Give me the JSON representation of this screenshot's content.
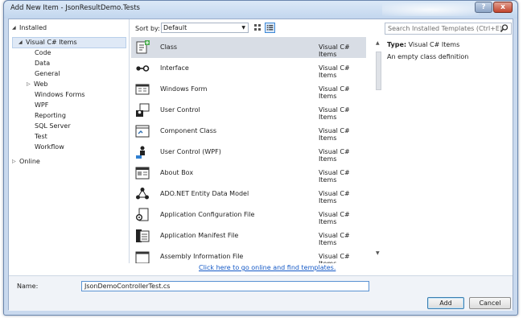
{
  "window": {
    "title": "Add New Item - JsonResultDemo.Tests",
    "help_label": "?",
    "close_label": "x"
  },
  "tree": {
    "installed": "Installed",
    "visual_cs": "Visual C# Items",
    "children": [
      "Code",
      "Data",
      "General",
      "Web",
      "Windows Forms",
      "WPF",
      "Reporting",
      "SQL Server",
      "Test",
      "Workflow"
    ],
    "online": "Online"
  },
  "sortbar": {
    "label": "Sort by:",
    "selected": "Default"
  },
  "templates": [
    {
      "name": "Class",
      "category": "Visual C# Items",
      "icon": "class-icon"
    },
    {
      "name": "Interface",
      "category": "Visual C# Items",
      "icon": "interface-icon"
    },
    {
      "name": "Windows Form",
      "category": "Visual C# Items",
      "icon": "windows-form-icon"
    },
    {
      "name": "User Control",
      "category": "Visual C# Items",
      "icon": "user-control-icon"
    },
    {
      "name": "Component Class",
      "category": "Visual C# Items",
      "icon": "component-class-icon"
    },
    {
      "name": "User Control (WPF)",
      "category": "Visual C# Items",
      "icon": "user-control-wpf-icon"
    },
    {
      "name": "About Box",
      "category": "Visual C# Items",
      "icon": "about-box-icon"
    },
    {
      "name": "ADO.NET Entity Data Model",
      "category": "Visual C# Items",
      "icon": "entity-data-model-icon"
    },
    {
      "name": "Application Configuration File",
      "category": "Visual C# Items",
      "icon": "config-file-icon"
    },
    {
      "name": "Application Manifest File",
      "category": "Visual C# Items",
      "icon": "manifest-file-icon"
    },
    {
      "name": "Assembly Information File",
      "category": "Visual C# Items",
      "icon": "assembly-info-icon"
    }
  ],
  "search": {
    "placeholder": "Search Installed Templates (Ctrl+E)"
  },
  "details": {
    "type_label": "Type:",
    "type_value": "Visual C# Items",
    "description": "An empty class definition"
  },
  "online_link": "Click here to go online and find templates.",
  "name_field": {
    "label": "Name:",
    "value": "JsonDemoControllerTest.cs"
  },
  "buttons": {
    "add": "Add",
    "cancel": "Cancel"
  },
  "colors": {
    "accent": "#3e88d6",
    "link": "#1358c6",
    "selection": "#d8dde5"
  }
}
